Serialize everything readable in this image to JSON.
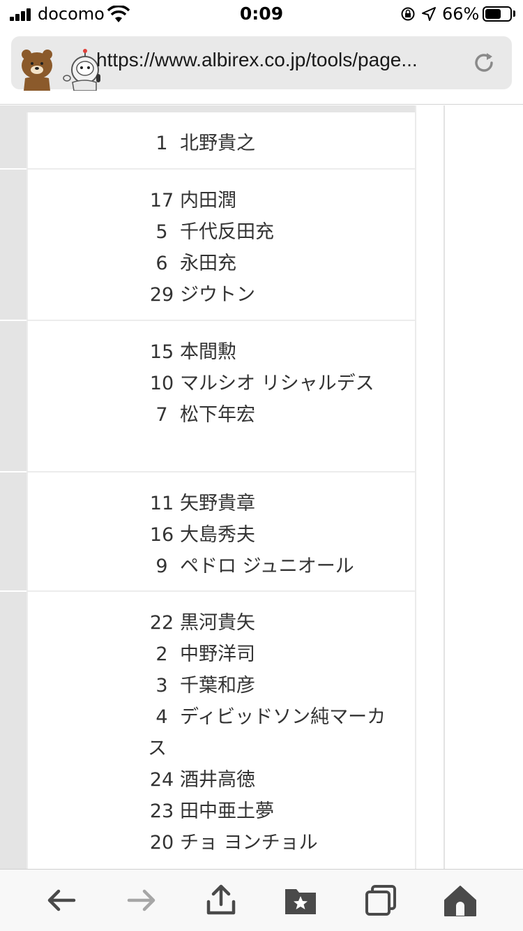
{
  "status_bar": {
    "carrier": "docomo",
    "time": "0:09",
    "battery_percent": "66%",
    "battery_level": 0.66
  },
  "browser": {
    "url": "https://www.albirex.co.jp/tools/page..."
  },
  "lineup": {
    "rows": [
      {
        "players": [
          {
            "number": "1",
            "name": "北野貴之"
          }
        ]
      },
      {
        "players": [
          {
            "number": "17",
            "name": "内田潤"
          },
          {
            "number": "5",
            "name": "千代反田充"
          },
          {
            "number": "6",
            "name": "永田充"
          },
          {
            "number": "29",
            "name": "ジウトン"
          }
        ]
      },
      {
        "players": [
          {
            "number": "15",
            "name": "本間勲"
          },
          {
            "number": "10",
            "name": "マルシオ リシャルデス"
          },
          {
            "number": "7",
            "name": "松下年宏"
          }
        ]
      },
      {
        "players": [
          {
            "number": "11",
            "name": "矢野貴章"
          },
          {
            "number": "16",
            "name": "大島秀夫"
          },
          {
            "number": "9",
            "name": "ペドロ ジュニオール"
          }
        ]
      },
      {
        "players": [
          {
            "number": "22",
            "name": "黒河貴矢"
          },
          {
            "number": "2",
            "name": "中野洋司"
          },
          {
            "number": "3",
            "name": "千葉和彦"
          },
          {
            "number": "4",
            "name": "ディビッドソン純マーカス"
          },
          {
            "number": "24",
            "name": "酒井高徳"
          },
          {
            "number": "23",
            "name": "田中亜土夢"
          },
          {
            "number": "20",
            "name": "チョ ヨンチョル"
          }
        ]
      }
    ]
  },
  "colors": {
    "accent_gray": "#e4e4e4",
    "text": "#333333",
    "icon": "#4a4a4a",
    "icon_disabled": "#a6a6a6"
  },
  "icons": {
    "back": "back-arrow-icon",
    "forward": "forward-arrow-icon",
    "share": "share-icon",
    "bookmarks": "bookmark-folder-icon",
    "tabs": "tabs-icon",
    "home": "home-icon"
  }
}
